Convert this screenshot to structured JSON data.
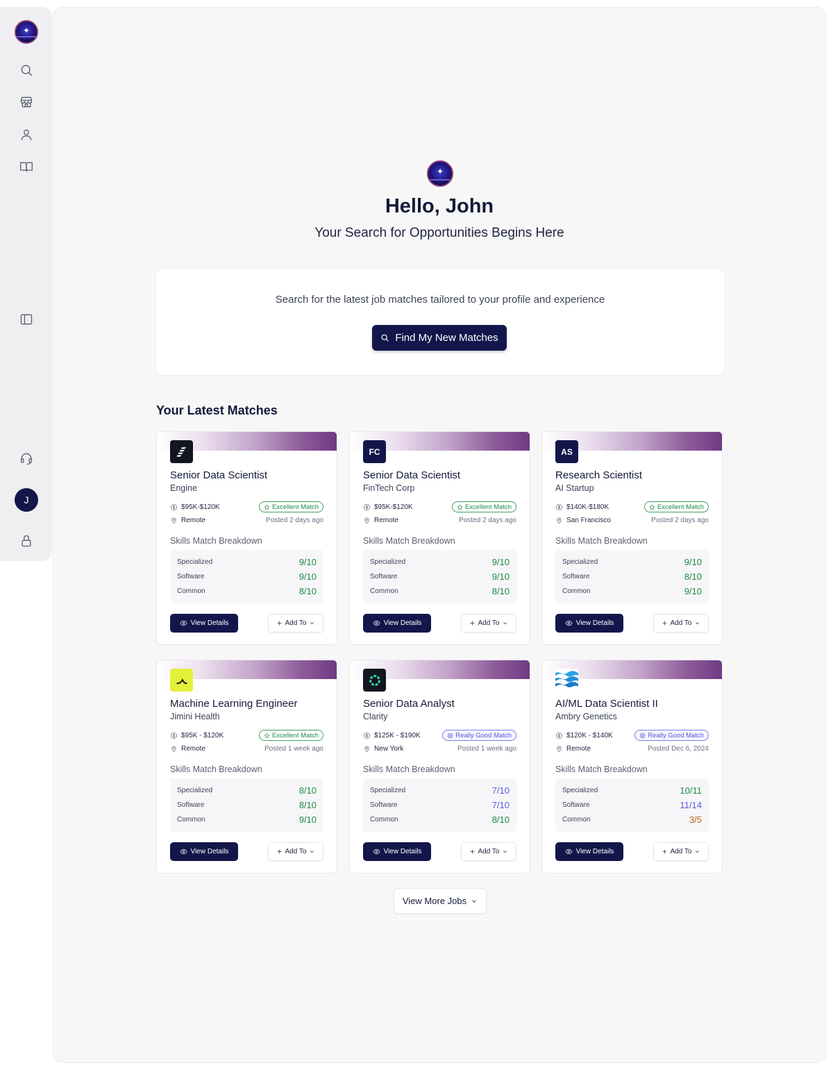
{
  "sidebar": {
    "avatar_initial": "J",
    "icons": [
      "app-logo-icon",
      "search-icon",
      "store-icon",
      "user-icon",
      "book-icon",
      "sidebar-toggle-icon",
      "headset-icon",
      "lock-icon"
    ]
  },
  "hero": {
    "greeting": "Hello, John",
    "tagline": "Your Search for Opportunities Begins Here"
  },
  "search_card": {
    "text": "Search for the latest job matches tailored to your profile and experience",
    "button_label": "Find My New Matches"
  },
  "matches": {
    "title": "Your Latest Matches",
    "skills_label": "Skills Match Breakdown",
    "view_label": "View Details",
    "add_label": "Add To",
    "jobs": [
      {
        "logo_text": "",
        "title": "Senior Data Scientist",
        "company": "Engine",
        "salary": "$95K-$120K",
        "badge": "Excellent Match",
        "location": "Remote",
        "posted": "Posted 2 days ago",
        "skills": [
          {
            "name": "Specialized",
            "value": "9/10"
          },
          {
            "name": "Software",
            "value": "9/10"
          },
          {
            "name": "Common",
            "value": "8/10"
          }
        ]
      },
      {
        "logo_text": "FC",
        "title": "Senior Data Scientist",
        "company": "FinTech Corp",
        "salary": "$95K-$120K",
        "badge": "Excellent Match",
        "location": "Remote",
        "posted": "Posted 2 days ago",
        "skills": [
          {
            "name": "Specialized",
            "value": "9/10"
          },
          {
            "name": "Software",
            "value": "9/10"
          },
          {
            "name": "Common",
            "value": "8/10"
          }
        ]
      },
      {
        "logo_text": "AS",
        "title": "Research Scientist",
        "company": "AI Startup",
        "salary": "$140K-$180K",
        "badge": "Excellent Match",
        "location": "San Francisco",
        "posted": "Posted 2 days ago",
        "skills": [
          {
            "name": "Specialized",
            "value": "9/10"
          },
          {
            "name": "Software",
            "value": "8/10"
          },
          {
            "name": "Common",
            "value": "9/10"
          }
        ]
      },
      {
        "logo_text": "",
        "title": "Machine Learning Engineer",
        "company": "Jimini Health",
        "salary": "$95K - $120K",
        "badge": "Excellent Match",
        "location": "Remote",
        "posted": "Posted 1 week ago",
        "skills": [
          {
            "name": "Specialized",
            "value": "8/10"
          },
          {
            "name": "Software",
            "value": "8/10"
          },
          {
            "name": "Common",
            "value": "9/10"
          }
        ]
      },
      {
        "logo_text": "",
        "title": "Senior Data Analyst",
        "company": "Clarity",
        "salary": "$125K - $190K",
        "badge": "Really Good Match",
        "location": "New York",
        "posted": "Posted 1 week ago",
        "skills": [
          {
            "name": "Specialized",
            "value": "7/10"
          },
          {
            "name": "Software",
            "value": "7/10"
          },
          {
            "name": "Common",
            "value": "8/10"
          }
        ]
      },
      {
        "logo_text": "",
        "title": "AI/ML Data Scientist II",
        "company": "Ambry Genetics",
        "salary": "$120K - $140K",
        "badge": "Really Good Match",
        "location": "Remote",
        "posted": "Posted Dec 6, 2024",
        "skills": [
          {
            "name": "Specialized",
            "value": "10/11"
          },
          {
            "name": "Software",
            "value": "11/14"
          },
          {
            "name": "Common",
            "value": "3/5"
          }
        ]
      }
    ]
  },
  "view_more_label": "View More Jobs",
  "colors": {
    "primary": "#13164a",
    "score_green": "#1f8a44",
    "score_blue": "#5a58de",
    "score_orange": "#c2621a",
    "band_purple": "#6e3a85"
  }
}
